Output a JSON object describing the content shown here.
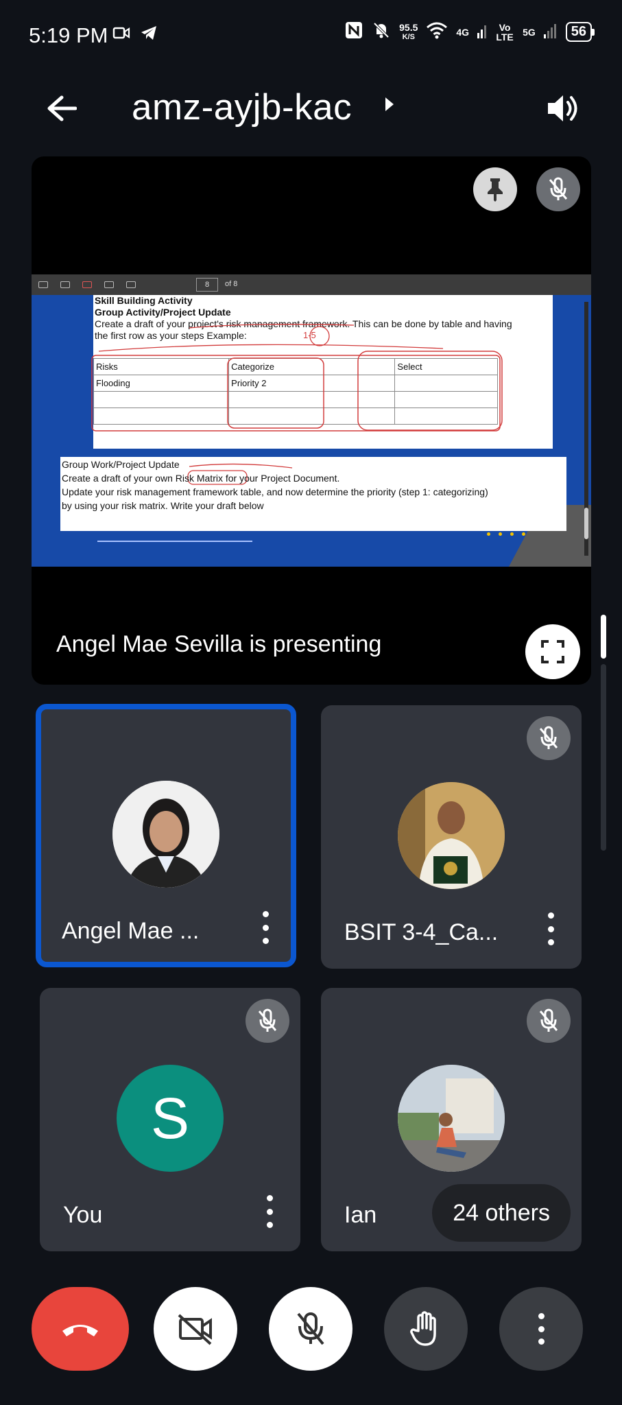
{
  "status_bar": {
    "time": "5:19 PM",
    "speed_value": "95.5",
    "speed_unit": "K/S",
    "network_4g": "4G",
    "volte": "Vo LTE",
    "network_5g": "5G",
    "battery": "56"
  },
  "header": {
    "meeting_code": "amz-ayjb-kac"
  },
  "presentation": {
    "presenting_label": "Angel Mae Sevilla is presenting",
    "pdf_page": "8",
    "pdf_of": "of 8",
    "slide": {
      "heading1": "Skill Building Activity",
      "heading2": "Group Activity/Project Update",
      "line1": "Create a draft of your project's risk management framework. This can be done by table and having",
      "line2": "the first row as your steps Example:",
      "col1": "Risks",
      "col2": "Categorize",
      "col3": "Select",
      "cell1": "Flooding",
      "cell2": "Priority 2",
      "annotation": "1-5",
      "box2_line1": "Group Work/Project Update",
      "box2_line2": "Create a draft of your own Risk Matrix for your Project Document.",
      "box2_line3": "Update your risk management framework table, and now determine the priority (step 1: categorizing)",
      "box2_line4": "by using your risk matrix. Write your draft below"
    }
  },
  "participants": [
    {
      "name": "Angel Mae ...",
      "active": true
    },
    {
      "name": "BSIT 3-4_Ca...",
      "muted": true
    },
    {
      "name": "You",
      "initial": "S",
      "muted": true
    },
    {
      "name": "Ian",
      "muted": true
    }
  ],
  "others_pill": "24 others",
  "colors": {
    "background": "#0f1218",
    "tile": "#32353d",
    "active_border": "#0b57d0",
    "end_call": "#e8453c",
    "avatar_teal": "#0b8f7e"
  }
}
